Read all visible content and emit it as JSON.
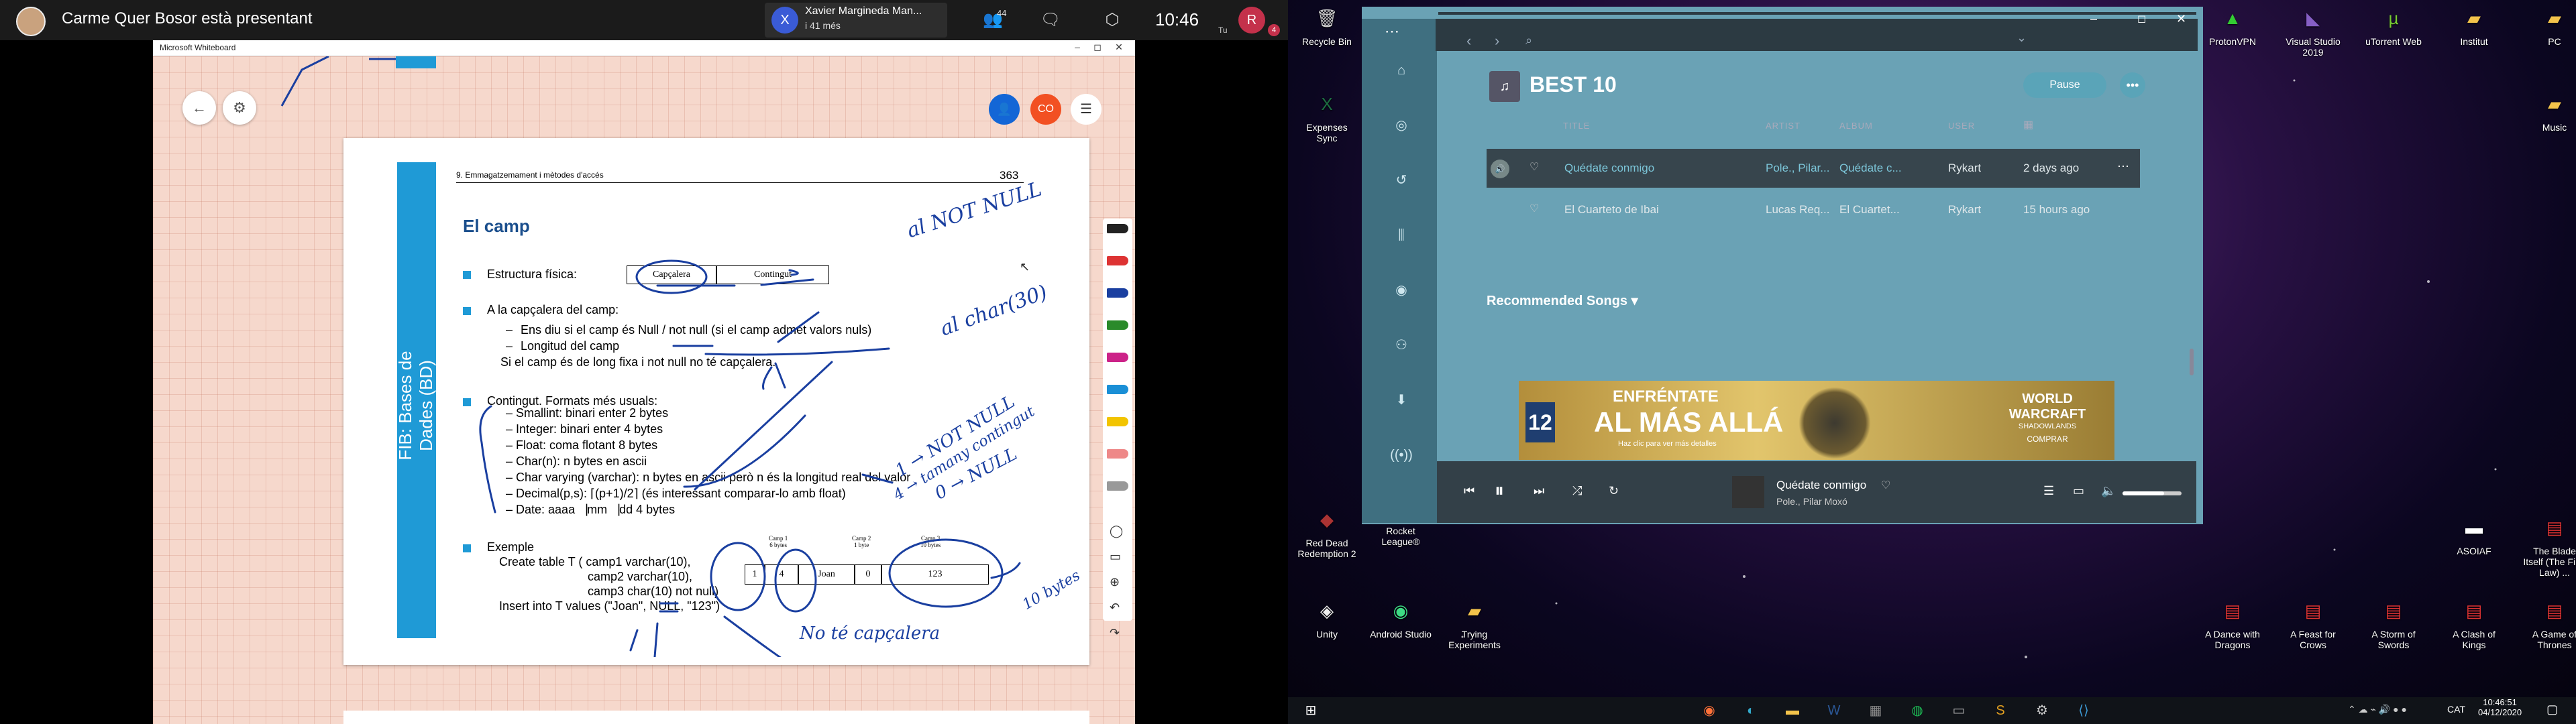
{
  "teams": {
    "presenter": "Carme Quer Bosor està presentant",
    "caller_name": "Xavier Margineda Man...",
    "caller_time": "i 41 més",
    "caller_initial": "X",
    "people_count": "44",
    "clock": "10:46",
    "self_initial": "R",
    "self_label": "Tu",
    "notification_count": "4"
  },
  "whiteboard": {
    "title": "Microsoft Whiteboard",
    "minimize": "–",
    "maximize": "◻",
    "close": "✕",
    "collab_label": "CO"
  },
  "document": {
    "sidebar_title": "FIB: Bases de Dades (BD)",
    "running_head": "9. Emmagatzemament i mètodes d'accés",
    "page_number": "363",
    "heading": "El camp",
    "physical_structure_label": "Estructura física:",
    "header_cell": "Capçalera",
    "content_cell": "Contingut",
    "header_section": "A la capçalera del camp:",
    "header_item1": "Ens diu si el camp és Null / not null  (si el camp admet valors nuls)",
    "header_item2": "Longitud del camp",
    "header_note": "Si el camp és de long fixa i not null no té capçalera.",
    "formats_section": "Contingut. Formats més usuals:",
    "formats": [
      "Smallint: binari enter 2 bytes",
      "Integer: binari enter 4 bytes",
      "Float: coma flotant 8 bytes",
      "Char(n): n bytes en ascii",
      "Char varying (varchar): n bytes en ascii però n és la longitud real del valor",
      "Decimal(p,s): ⌈(p+1)/2⌉ (és interessant comparar-lo amb float)",
      "Date: aaaa⎹mm⎹dd 4 bytes"
    ],
    "example_section": "Exemple",
    "example_lines": [
      "Create table T ( camp1 varchar(10),",
      "camp2 varchar(10),",
      "camp3 char(10) not null)",
      "Insert into T values (\"Joan\", NULL, \"123\")"
    ],
    "table_cells": [
      "1",
      "4",
      "Joan",
      "0",
      "123"
    ],
    "table_labels": [
      "Camp 1\n6 bytes",
      "Camp 2\n1 byte",
      "Camp 3\n10 bytes"
    ],
    "annotations": [
      "al NOT NULL",
      "al char(30)",
      "1 → NOT NULL",
      "4 → tamany contingut",
      "0 → NULL",
      "10 bytes",
      "No té capçalera"
    ]
  },
  "desktop": {
    "icons_left": [
      {
        "label": "Recycle Bin",
        "icon": "trash-icon"
      },
      {
        "label": "Expenses Sync",
        "icon": "excel-icon"
      },
      {
        "label": "Red Dead Redemption 2",
        "icon": "game-icon"
      },
      {
        "label": "Rocket League®",
        "icon": "game-icon"
      },
      {
        "label": "Unity",
        "icon": "unity-icon"
      },
      {
        "label": "Android Studio",
        "icon": "android-icon"
      },
      {
        "label": "Trying Experiments",
        "icon": "folder-icon"
      }
    ],
    "icons_right": [
      {
        "label": "ProtonVPN",
        "icon": "vpn-icon"
      },
      {
        "label": "Visual Studio 2019",
        "icon": "vs-icon"
      },
      {
        "label": "uTorrent Web",
        "icon": "torrent-icon"
      },
      {
        "label": "Institut",
        "icon": "folder-icon"
      },
      {
        "label": "PC",
        "icon": "folder-icon"
      },
      {
        "label": "Music",
        "icon": "folder-icon"
      },
      {
        "label": "ASOIAF",
        "icon": "file-icon"
      },
      {
        "label": "The Blade Itself (The First Law) ...",
        "icon": "pdf-icon"
      },
      {
        "label": "A Dance with Dragons",
        "icon": "pdf-icon"
      },
      {
        "label": "A Feast for Crows",
        "icon": "pdf-icon"
      },
      {
        "label": "A Storm of Swords",
        "icon": "pdf-icon"
      },
      {
        "label": "A Clash of Kings",
        "icon": "pdf-icon"
      },
      {
        "label": "A Game of Thrones",
        "icon": "pdf-icon"
      }
    ]
  },
  "music": {
    "playlist_title": "BEST 10",
    "pause_label": "Pause",
    "more_label": "•••",
    "columns": [
      "TITLE",
      "ARTIST",
      "ALBUM",
      "USER"
    ],
    "tracks": [
      {
        "title": "Quédate conmigo",
        "artist": "Pole., Pilar...",
        "album": "Quédate c...",
        "user": "Rykart",
        "added": "2 days ago"
      },
      {
        "title": "El Cuarteto de Ibai",
        "artist": "Lucas Req...",
        "album": "El Cuartet...",
        "user": "Rykart",
        "added": "15 hours ago"
      }
    ],
    "recommended": "Recommended Songs ▾",
    "ad_left": "ENFRÉNTATE",
    "ad_main": "AL MÁS ALLÁ",
    "ad_sub": "Haz clic para ver más detalles",
    "ad_pegi": "12",
    "ad_brand": "WORLD WARCRAFT",
    "ad_brand_sub": "SHADOWLANDS",
    "ad_cta": "COMPRAR",
    "now_title": "Quédate conmigo",
    "now_artist": "Pole., Pilar Moxó",
    "volume_level": 0.7,
    "accent": "#5aa4b8"
  },
  "taskbar": {
    "time": "10:46:51",
    "date": "04/12/2020",
    "lang": "CAT"
  }
}
